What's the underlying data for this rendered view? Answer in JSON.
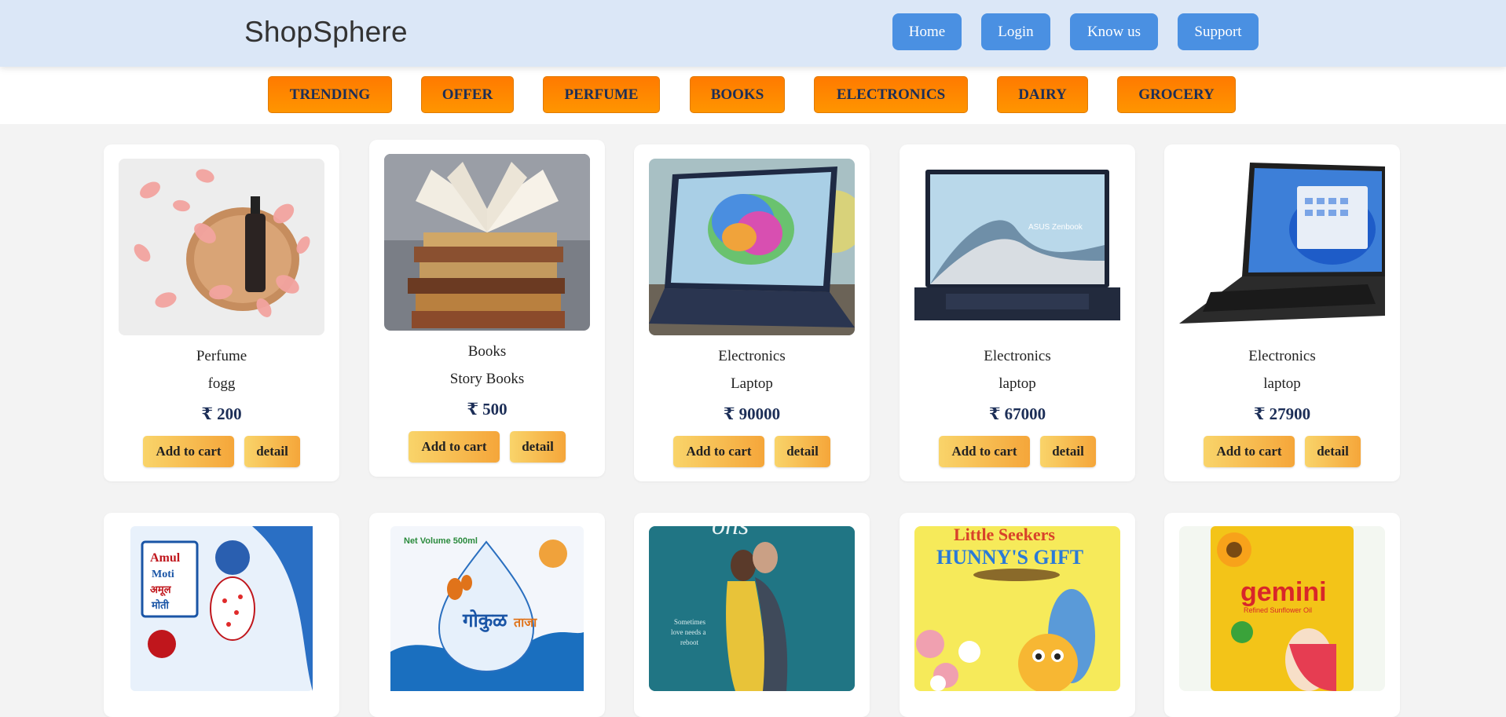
{
  "header": {
    "brand": "ShopSphere",
    "nav": [
      "Home",
      "Login",
      "Know us",
      "Support"
    ]
  },
  "categories": [
    "TRENDING",
    "OFFER",
    "PERFUME",
    "BOOKS",
    "ELECTRONICS",
    "DAIRY",
    "GROCERY"
  ],
  "currency_symbol": "₹",
  "products": [
    {
      "category": "Perfume",
      "name": "fogg",
      "price": "₹ 200",
      "image": "perfume-bottle-with-rose-petals"
    },
    {
      "category": "Books",
      "name": "Story Books",
      "price": "₹ 500",
      "image": "stack-of-books"
    },
    {
      "category": "Electronics",
      "name": "Laptop",
      "price": "₹ 90000",
      "image": "laptop-colorful-wallpaper"
    },
    {
      "category": "Electronics",
      "name": "laptop",
      "price": "₹ 67000",
      "image": "asus-zenbook-laptop"
    },
    {
      "category": "Electronics",
      "name": "laptop",
      "price": "₹ 27900",
      "image": "black-laptop-windows"
    }
  ],
  "products_row2": [
    {
      "image": "amul-moti-milk-packet",
      "label_lines": [
        "Amul",
        "Moti",
        "अमूल",
        "मोती"
      ]
    },
    {
      "image": "gokul-milk-packet",
      "label_lines": [
        "Net Volume 500ml",
        "गोकुळ",
        "ताजा"
      ]
    },
    {
      "image": "romance-book-cover",
      "label_lines": [
        "Sometimes",
        "love needs a",
        "reboot"
      ]
    },
    {
      "image": "little-seekers-book-cover",
      "label_lines": [
        "Little Seekers",
        "HUNNY'S GIFT"
      ]
    },
    {
      "image": "gemini-sunflower-oil",
      "label_lines": [
        "gemini",
        "Refined Sunflower Oil"
      ]
    }
  ],
  "buttons": {
    "add_to_cart": "Add to cart",
    "detail": "detail"
  },
  "colors": {
    "header_bg": "#dbe7f7",
    "nav_button": "#4a90e2",
    "category_button": "#ff8a00",
    "cart_button_gradient_start": "#f9d46a",
    "cart_button_gradient_end": "#f5a63a",
    "price_text": "#1c2e57"
  }
}
